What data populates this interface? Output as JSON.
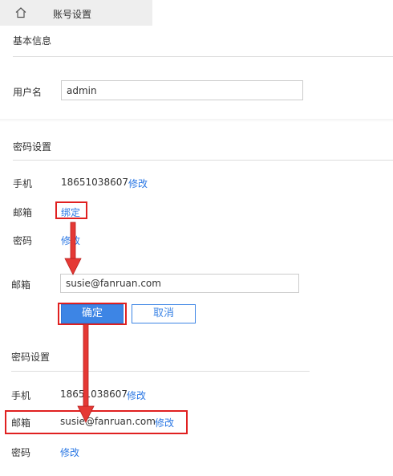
{
  "tab": {
    "home_icon": "home-icon",
    "title": "账号设置"
  },
  "basic": {
    "title": "基本信息",
    "username_label": "用户名",
    "username_value": "admin"
  },
  "password_section_1": {
    "title": "密码设置",
    "phone_label": "手机",
    "phone_value": "18651038607",
    "phone_action": "修改",
    "email_label": "邮箱",
    "email_action": "绑定",
    "password_label": "密码",
    "password_action": "修改"
  },
  "bind_form": {
    "email_label": "邮箱",
    "email_value": "susie@fanruan.com",
    "confirm": "确定",
    "cancel": "取消"
  },
  "password_section_2": {
    "title": "密码设置",
    "phone_label": "手机",
    "phone_value": "18651038607",
    "phone_action": "修改",
    "email_label": "邮箱",
    "email_value": "susie@fanruan.com",
    "email_action": "修改",
    "password_label": "密码",
    "password_action": "修改"
  },
  "colors": {
    "link": "#2b78e4",
    "highlight": "#e02020",
    "primary": "#3d85e5"
  }
}
